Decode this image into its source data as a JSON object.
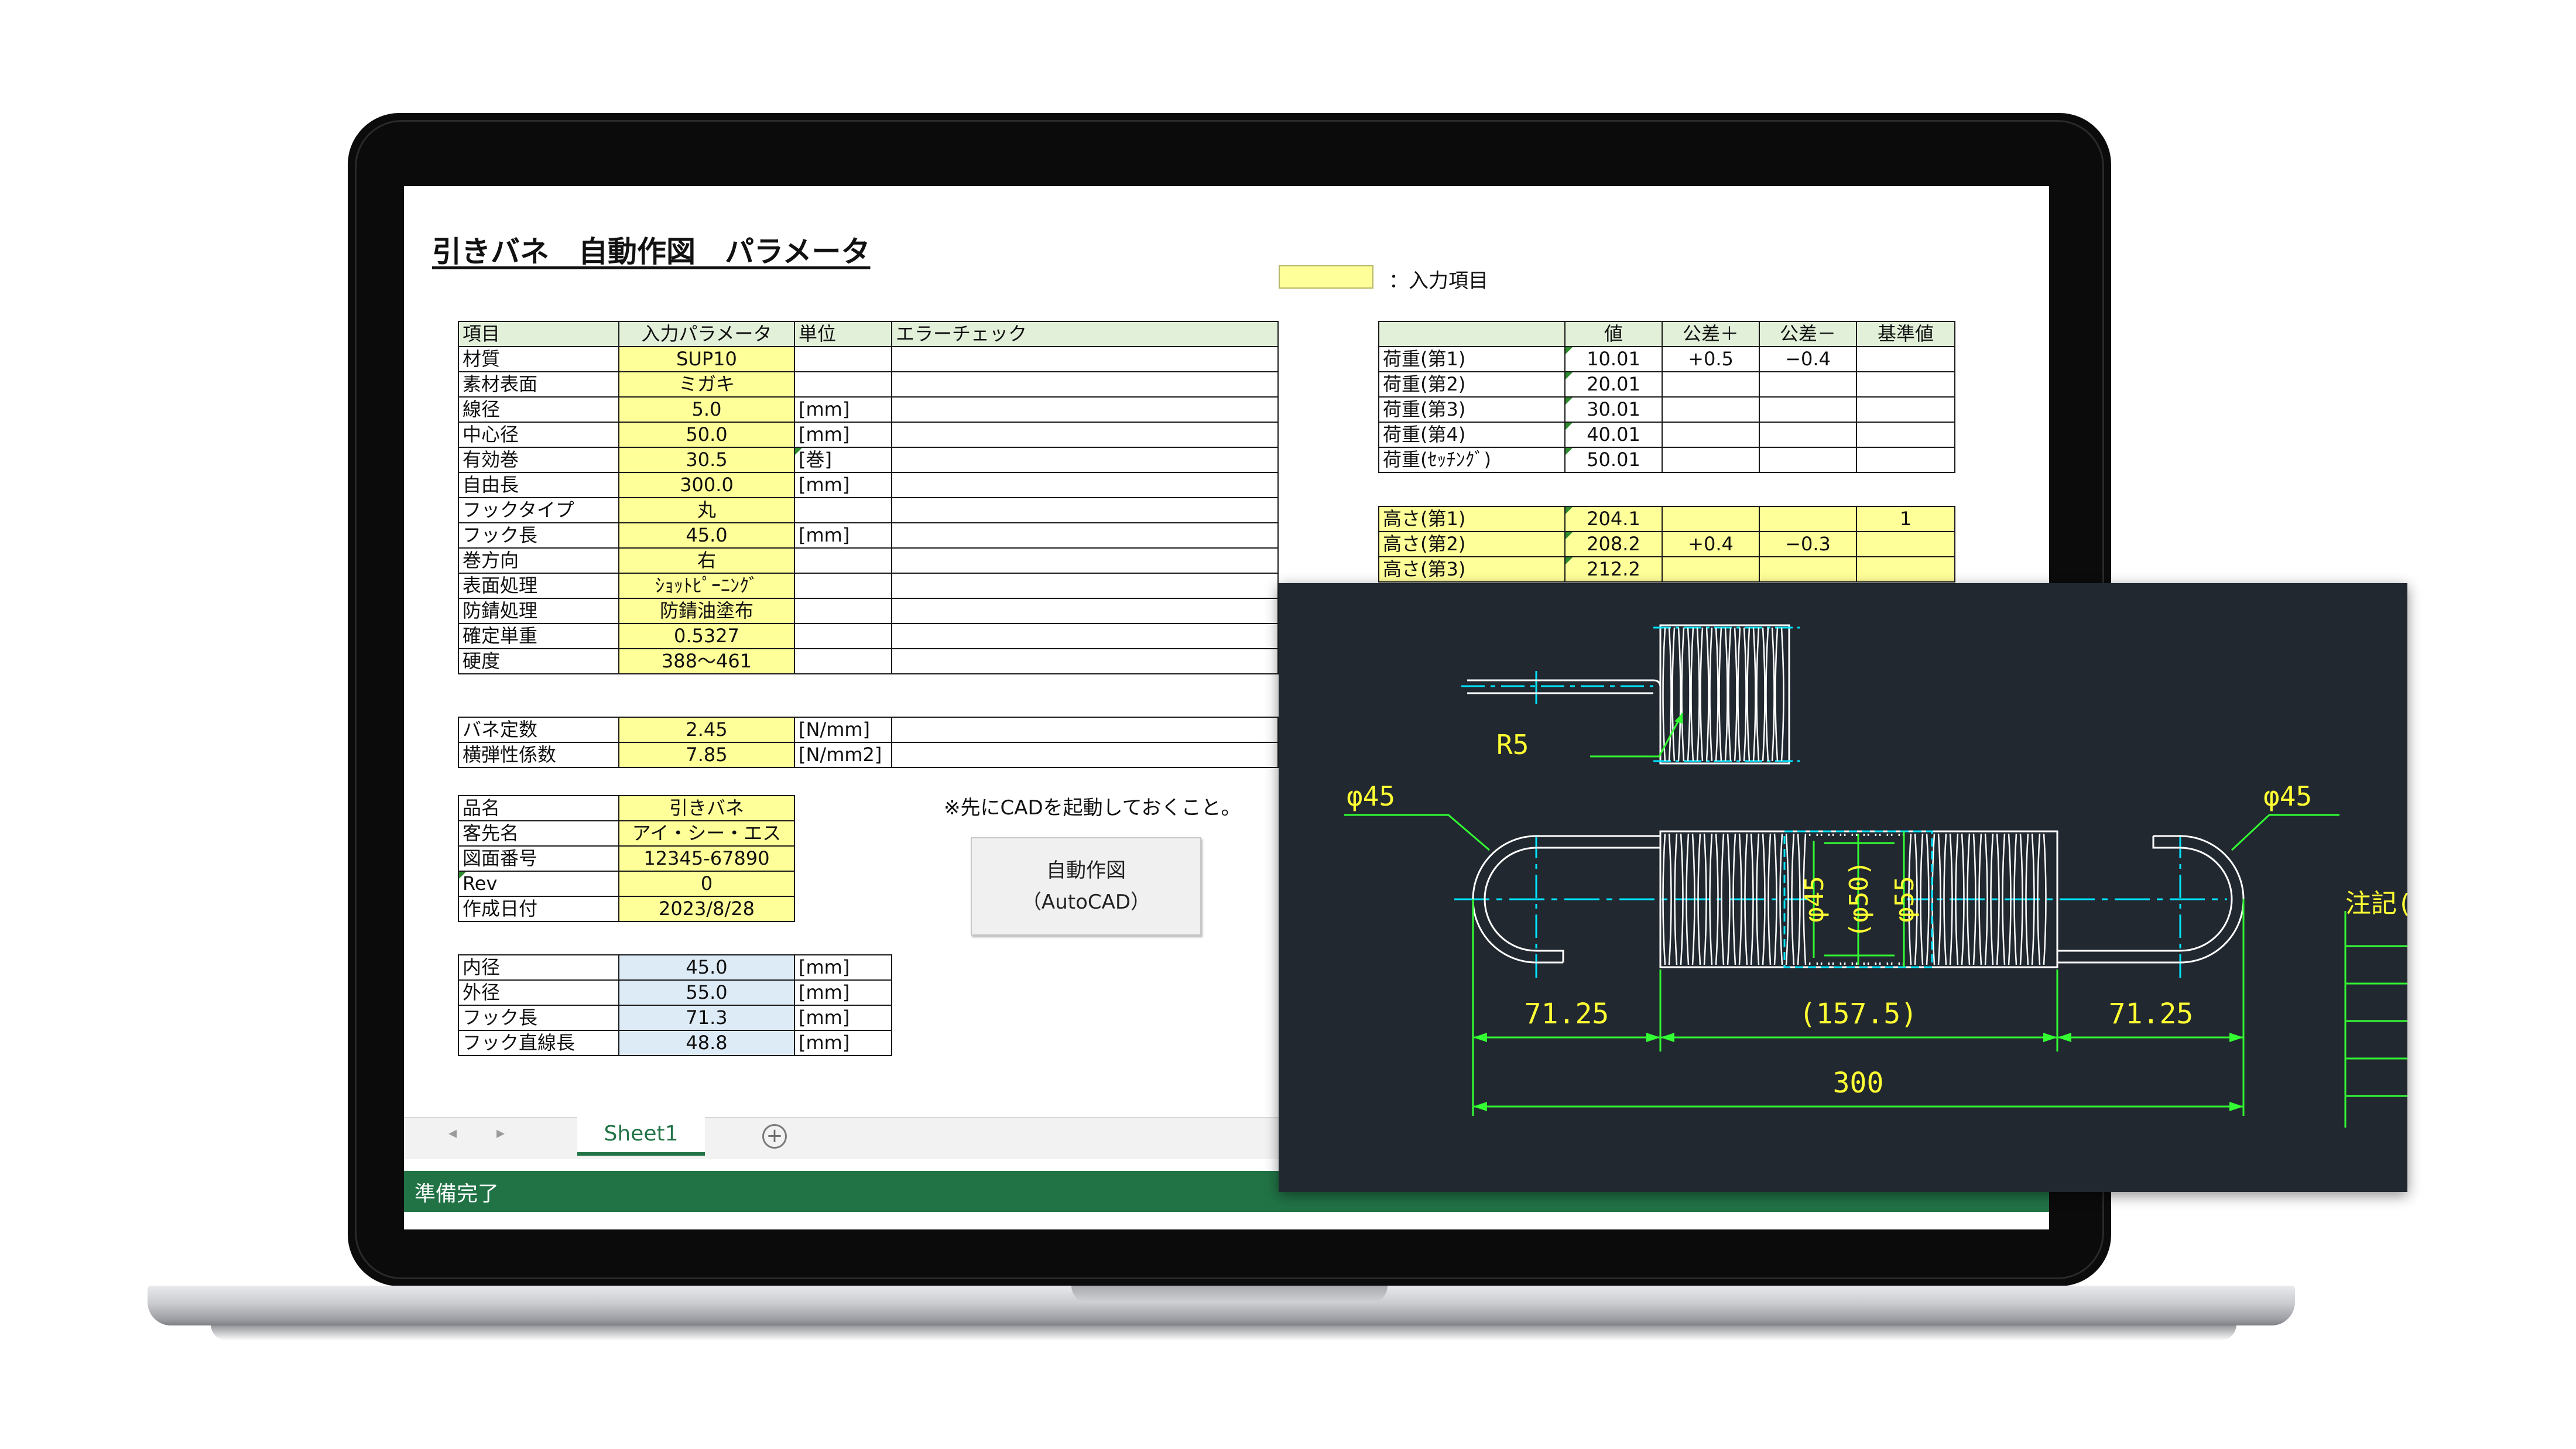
{
  "title": "引きバネ　自動作図　パラメータ",
  "legend": {
    "label": "：入力項目",
    "color": "#ffff99"
  },
  "params_table": {
    "headers": [
      "項目",
      "入力パラメータ",
      "単位",
      "エラーチェック"
    ],
    "rows": [
      {
        "item": "材質",
        "value": "SUP10",
        "unit": ""
      },
      {
        "item": "素材表面",
        "value": "ミガキ",
        "unit": ""
      },
      {
        "item": "線径",
        "value": "5.0",
        "unit": "[mm]"
      },
      {
        "item": "中心径",
        "value": "50.0",
        "unit": "[mm]"
      },
      {
        "item": "有効巻",
        "value": "30.5",
        "unit": "[巻]"
      },
      {
        "item": "自由長",
        "value": "300.0",
        "unit": "[mm]"
      },
      {
        "item": "フックタイプ",
        "value": "丸",
        "unit": ""
      },
      {
        "item": "フック長",
        "value": "45.0",
        "unit": "[mm]"
      },
      {
        "item": "巻方向",
        "value": "右",
        "unit": ""
      },
      {
        "item": "表面処理",
        "value": "ｼｮｯﾄﾋﾟｰﾆﾝｸﾞ",
        "unit": ""
      },
      {
        "item": "防錆処理",
        "value": "防錆油塗布",
        "unit": ""
      },
      {
        "item": "確定単重",
        "value": "0.5327",
        "unit": ""
      },
      {
        "item": "硬度",
        "value": "388～461",
        "unit": ""
      }
    ]
  },
  "spring_table": {
    "rows": [
      {
        "item": "バネ定数",
        "value": "2.45",
        "unit": "[N/mm]"
      },
      {
        "item": "横弾性係数",
        "value": "7.85",
        "unit": "[N/mm2]"
      }
    ]
  },
  "drawing_table": {
    "rows": [
      {
        "item": "品名",
        "value": "引きバネ"
      },
      {
        "item": "客先名",
        "value": "アイ・シー・エス"
      },
      {
        "item": "図面番号",
        "value": "12345-67890"
      },
      {
        "item": "Rev",
        "value": "0"
      },
      {
        "item": "作成日付",
        "value": "2023/8/28"
      }
    ]
  },
  "calc_table": {
    "rows": [
      {
        "item": "内径",
        "value": "45.0",
        "unit": "[mm]"
      },
      {
        "item": "外径",
        "value": "55.0",
        "unit": "[mm]"
      },
      {
        "item": "フック長",
        "value": "71.3",
        "unit": "[mm]"
      },
      {
        "item": "フック直線長",
        "value": "48.8",
        "unit": "[mm]"
      }
    ]
  },
  "note": "※先にCADを起動しておくこと。",
  "button": {
    "line1": "自動作図",
    "line2": "（AutoCAD）"
  },
  "load_table": {
    "headers": [
      "",
      "値",
      "公差＋",
      "公差－",
      "基準値"
    ],
    "rows": [
      {
        "item": "荷重(第1)",
        "value": "10.01",
        "tol_plus": "+0.5",
        "tol_minus": "−0.4",
        "base": ""
      },
      {
        "item": "荷重(第2)",
        "value": "20.01",
        "tol_plus": "",
        "tol_minus": "",
        "base": ""
      },
      {
        "item": "荷重(第3)",
        "value": "30.01",
        "tol_plus": "",
        "tol_minus": "",
        "base": ""
      },
      {
        "item": "荷重(第4)",
        "value": "40.01",
        "tol_plus": "",
        "tol_minus": "",
        "base": ""
      },
      {
        "item": "荷重(ｾｯﾁﾝｸﾞ)",
        "value": "50.01",
        "tol_plus": "",
        "tol_minus": "",
        "base": ""
      }
    ]
  },
  "height_table": {
    "rows": [
      {
        "item": "高さ(第1)",
        "value": "204.1",
        "tol_plus": "",
        "tol_minus": "",
        "base": "1"
      },
      {
        "item": "高さ(第2)",
        "value": "208.2",
        "tol_plus": "+0.4",
        "tol_minus": "−0.3",
        "base": ""
      },
      {
        "item": "高さ(第3)",
        "value": "212.2",
        "tol_plus": "",
        "tol_minus": "",
        "base": ""
      }
    ]
  },
  "sheet_tabs": {
    "active": "Sheet1"
  },
  "status_bar": {
    "text": "準備完了"
  },
  "cad": {
    "labels": {
      "radius": "R5",
      "left_hook_dia": "φ45",
      "right_hook_dia": "φ45",
      "inner_dia": "φ45",
      "mid_dia": "(φ50)",
      "outer_dia": "φ55",
      "left_hook_len": "71.25",
      "body_len": "(157.5)",
      "right_hook_len": "71.25",
      "total_len": "300",
      "notes_label": "注記("
    },
    "colors": {
      "background": "#212830",
      "outline": "#ffffff",
      "center": "#00e5ff",
      "dimension": "#33ff33",
      "text": "#ffff33"
    }
  }
}
